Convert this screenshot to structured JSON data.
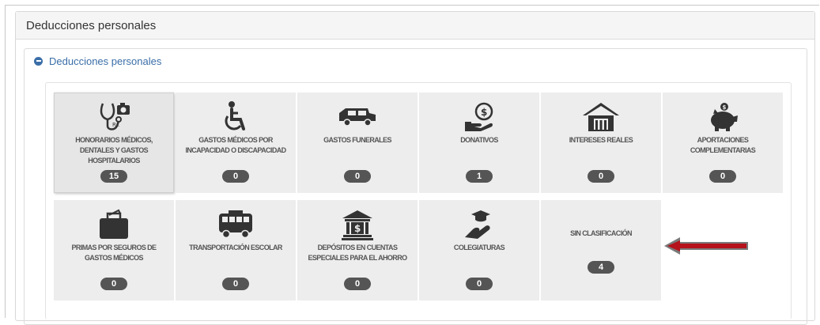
{
  "panel": {
    "title": "Deducciones personales"
  },
  "section": {
    "title": "Deducciones personales"
  },
  "tiles": [
    {
      "label": "HONORARIOS MÉDICOS, DENTALES Y GASTOS HOSPITALARIOS",
      "count": "15",
      "icon": "stethoscope-camera-icon"
    },
    {
      "label": "GASTOS MÉDICOS POR INCAPACIDAD O DISCAPACIDAD",
      "count": "0",
      "icon": "wheelchair-icon"
    },
    {
      "label": "GASTOS FUNERALES",
      "count": "0",
      "icon": "hearse-icon"
    },
    {
      "label": "DONATIVOS",
      "count": "1",
      "icon": "hand-coin-icon"
    },
    {
      "label": "INTERESES REALES",
      "count": "0",
      "icon": "house-icon"
    },
    {
      "label": "APORTACIONES COMPLEMENTARIAS",
      "count": "0",
      "icon": "piggy-bank-icon"
    },
    {
      "label": "PRIMAS POR SEGUROS DE GASTOS MÉDICOS",
      "count": "0",
      "icon": "briefcase-icon"
    },
    {
      "label": "TRANSPORTACIÓN ESCOLAR",
      "count": "0",
      "icon": "school-bus-icon"
    },
    {
      "label": "DEPÓSITOS EN CUENTAS ESPECIALES PARA EL AHORRO",
      "count": "0",
      "icon": "bank-icon"
    },
    {
      "label": "COLEGIATURAS",
      "count": "0",
      "icon": "graduation-hand-icon"
    },
    {
      "label": "SIN CLASIFICACIÓN",
      "count": "4",
      "icon": "none"
    }
  ],
  "colors": {
    "accent": "#3a6ea8",
    "arrow": "#b5121b",
    "badge": "#555555"
  }
}
